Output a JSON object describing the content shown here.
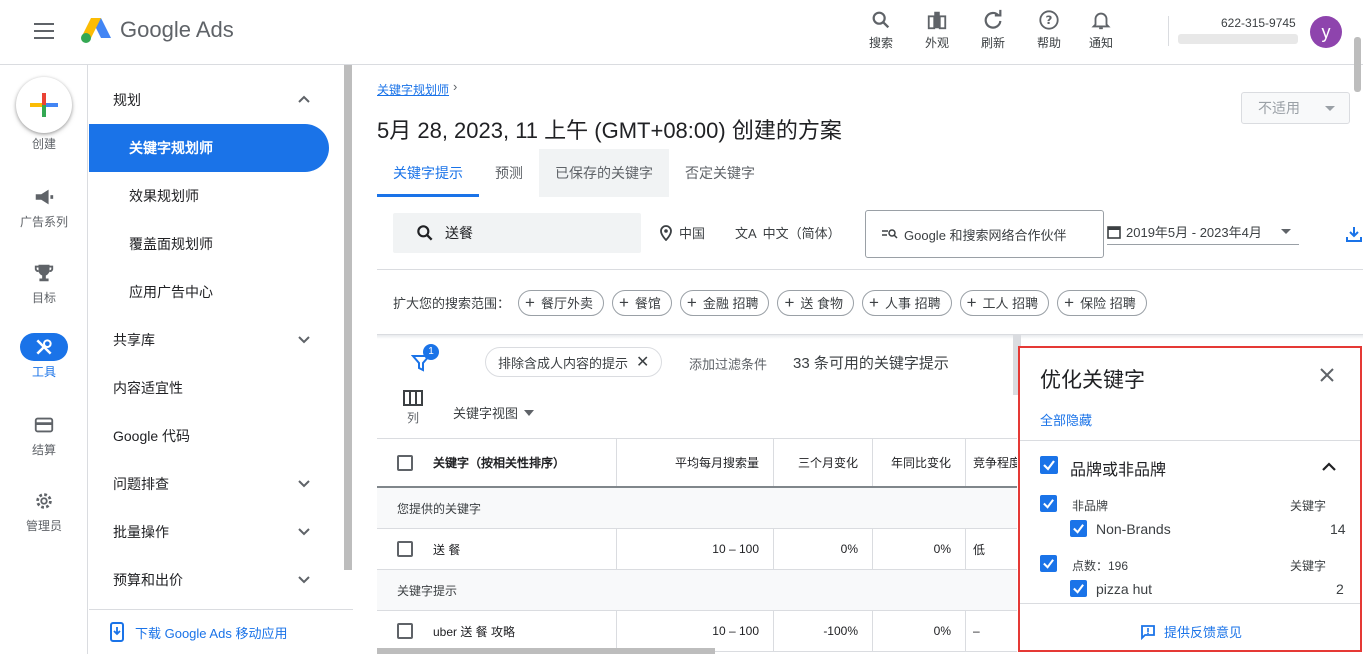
{
  "header": {
    "logo_text": "Google Ads",
    "icons": [
      {
        "label": "搜索",
        "icon": "search-icon"
      },
      {
        "label": "外观",
        "icon": "appearance-icon"
      },
      {
        "label": "刷新",
        "icon": "refresh-icon"
      },
      {
        "label": "帮助",
        "icon": "help-icon"
      },
      {
        "label": "通知",
        "icon": "bell-icon"
      }
    ],
    "account_id": "622-315-9745",
    "avatar_letter": "y"
  },
  "rail": {
    "create": "创建",
    "campaigns": "广告系列",
    "goals": "目标",
    "tools": "工具",
    "billing": "结算",
    "admin": "管理员"
  },
  "nav": {
    "planning": "规划",
    "keyword_planner": "关键字规划师",
    "performance_planner": "效果规划师",
    "reach_planner": "覆盖面规划师",
    "app_center": "应用广告中心",
    "shared_library": "共享库",
    "content_suitability": "内容适宜性",
    "google_tag": "Google 代码",
    "troubleshooting": "问题排查",
    "bulk_actions": "批量操作",
    "budgets_bids": "预算和出价",
    "download_app": "下载 Google Ads 移动应用"
  },
  "main": {
    "breadcrumb": "关键字规划师",
    "title": "5月 28, 2023, 11 上午 (GMT+08:00) 创建的方案",
    "na_select": "不适用",
    "tabs": [
      "关键字提示",
      "预测",
      "已保存的关键字",
      "否定关键字"
    ],
    "search_term": "送餐",
    "location": "中国",
    "language": "中文（简体）",
    "network": "Google 和搜索网络合作伙伴",
    "date_range": "2019年5月 - 2023年4月",
    "broaden_label": "扩大您的搜索范围：",
    "broaden_chips": [
      "餐厅外卖",
      "餐馆",
      "金融 招聘",
      "送 食物",
      "人事 招聘",
      "工人 招聘",
      "保险 招聘"
    ],
    "filter_count": "1",
    "filter_chip": "排除含成人内容的提示",
    "add_filter": "添加过滤条件",
    "kw_count": "33 条可用的关键字提示",
    "columns_label": "列",
    "kw_view": "关键字视图"
  },
  "table": {
    "headers": [
      "关键字（按相关性排序）",
      "平均每月搜索量",
      "三个月变化",
      "年同比变化",
      "竞争程度"
    ],
    "section_provided": "您提供的关键字",
    "provided_rows": [
      {
        "keyword": "送 餐",
        "volume": "10 – 100",
        "three_month": "0%",
        "yoy": "0%",
        "competition": "低"
      }
    ],
    "section_ideas": "关键字提示",
    "idea_rows": [
      {
        "keyword": "uber 送 餐 攻略",
        "volume": "10 – 100",
        "three_month": "-100%",
        "yoy": "0%",
        "competition": "–"
      }
    ]
  },
  "refine_panel": {
    "title": "优化关键字",
    "hide_all": "全部隐藏",
    "group_title": "品牌或非品牌",
    "sub1_label": "非品牌",
    "sub1_col": "关键字",
    "sub1_item": "Non-Brands",
    "sub1_count": "14",
    "sub2_label": "点数：196",
    "sub2_col": "关键字",
    "sub2_item": "pizza hut",
    "sub2_count": "2",
    "feedback": "提供反馈意见"
  },
  "colors": {
    "accent": "#1a73e8",
    "highlight_border": "#e53935",
    "avatar": "#8e44ad"
  }
}
